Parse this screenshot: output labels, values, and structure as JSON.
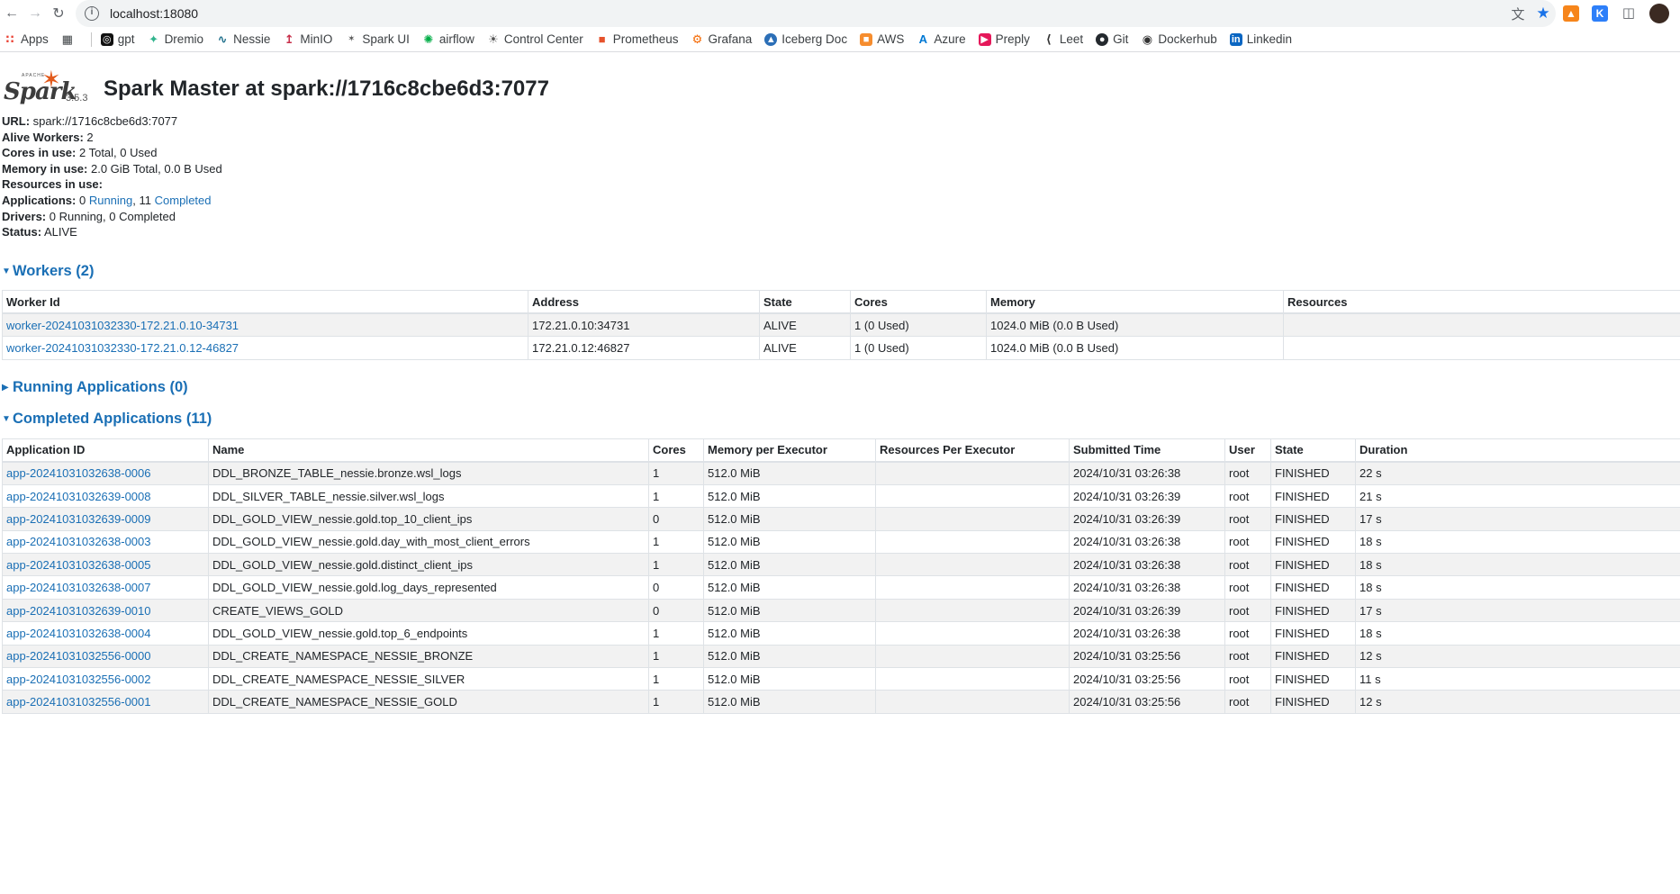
{
  "browser": {
    "url": "localhost:18080",
    "bookmarks": [
      "Apps",
      "gpt",
      "Dremio",
      "Nessie",
      "MinIO",
      "Spark UI",
      "airflow",
      "Control Center",
      "Prometheus",
      "Grafana",
      "Iceberg Doc",
      "AWS",
      "Azure",
      "Preply",
      "Leet",
      "Git",
      "Dockerhub",
      "Linkedin"
    ]
  },
  "header": {
    "logo_apache": "APACHE",
    "logo_word": "Spark",
    "version": "3.5.3",
    "title": "Spark Master at spark://1716c8cbe6d3:7077"
  },
  "summary": {
    "url_label": "URL:",
    "url_value": "spark://1716c8cbe6d3:7077",
    "workers_label": "Alive Workers:",
    "workers_value": "2",
    "cores_label": "Cores in use:",
    "cores_value": "2 Total, 0 Used",
    "memory_label": "Memory in use:",
    "memory_value": "2.0 GiB Total, 0.0 B Used",
    "resources_label": "Resources in use:",
    "apps_label": "Applications:",
    "apps_running_count": "0",
    "apps_running_link": "Running",
    "apps_completed_count": "11",
    "apps_completed_link": "Completed",
    "drivers_label": "Drivers:",
    "drivers_value": "0 Running, 0 Completed",
    "status_label": "Status:",
    "status_value": "ALIVE"
  },
  "workers": {
    "heading": "Workers (2)",
    "columns": [
      "Worker Id",
      "Address",
      "State",
      "Cores",
      "Memory",
      "Resources"
    ],
    "rows": [
      [
        "worker-20241031032330-172.21.0.10-34731",
        "172.21.0.10:34731",
        "ALIVE",
        "1 (0 Used)",
        "1024.0 MiB (0.0 B Used)",
        ""
      ],
      [
        "worker-20241031032330-172.21.0.12-46827",
        "172.21.0.12:46827",
        "ALIVE",
        "1 (0 Used)",
        "1024.0 MiB (0.0 B Used)",
        ""
      ]
    ]
  },
  "running": {
    "heading": "Running Applications (0)"
  },
  "completed": {
    "heading": "Completed Applications (11)",
    "columns": [
      "Application ID",
      "Name",
      "Cores",
      "Memory per Executor",
      "Resources Per Executor",
      "Submitted Time",
      "User",
      "State",
      "Duration"
    ],
    "rows": [
      [
        "app-20241031032638-0006",
        "DDL_BRONZE_TABLE_nessie.bronze.wsl_logs",
        "1",
        "512.0 MiB",
        "",
        "2024/10/31 03:26:38",
        "root",
        "FINISHED",
        "22 s"
      ],
      [
        "app-20241031032639-0008",
        "DDL_SILVER_TABLE_nessie.silver.wsl_logs",
        "1",
        "512.0 MiB",
        "",
        "2024/10/31 03:26:39",
        "root",
        "FINISHED",
        "21 s"
      ],
      [
        "app-20241031032639-0009",
        "DDL_GOLD_VIEW_nessie.gold.top_10_client_ips",
        "0",
        "512.0 MiB",
        "",
        "2024/10/31 03:26:39",
        "root",
        "FINISHED",
        "17 s"
      ],
      [
        "app-20241031032638-0003",
        "DDL_GOLD_VIEW_nessie.gold.day_with_most_client_errors",
        "1",
        "512.0 MiB",
        "",
        "2024/10/31 03:26:38",
        "root",
        "FINISHED",
        "18 s"
      ],
      [
        "app-20241031032638-0005",
        "DDL_GOLD_VIEW_nessie.gold.distinct_client_ips",
        "1",
        "512.0 MiB",
        "",
        "2024/10/31 03:26:38",
        "root",
        "FINISHED",
        "18 s"
      ],
      [
        "app-20241031032638-0007",
        "DDL_GOLD_VIEW_nessie.gold.log_days_represented",
        "0",
        "512.0 MiB",
        "",
        "2024/10/31 03:26:38",
        "root",
        "FINISHED",
        "18 s"
      ],
      [
        "app-20241031032639-0010",
        "CREATE_VIEWS_GOLD",
        "0",
        "512.0 MiB",
        "",
        "2024/10/31 03:26:39",
        "root",
        "FINISHED",
        "17 s"
      ],
      [
        "app-20241031032638-0004",
        "DDL_GOLD_VIEW_nessie.gold.top_6_endpoints",
        "1",
        "512.0 MiB",
        "",
        "2024/10/31 03:26:38",
        "root",
        "FINISHED",
        "18 s"
      ],
      [
        "app-20241031032556-0000",
        "DDL_CREATE_NAMESPACE_NESSIE_BRONZE",
        "1",
        "512.0 MiB",
        "",
        "2024/10/31 03:25:56",
        "root",
        "FINISHED",
        "12 s"
      ],
      [
        "app-20241031032556-0002",
        "DDL_CREATE_NAMESPACE_NESSIE_SILVER",
        "1",
        "512.0 MiB",
        "",
        "2024/10/31 03:25:56",
        "root",
        "FINISHED",
        "11 s"
      ],
      [
        "app-20241031032556-0001",
        "DDL_CREATE_NAMESPACE_NESSIE_GOLD",
        "1",
        "512.0 MiB",
        "",
        "2024/10/31 03:25:56",
        "root",
        "FINISHED",
        "12 s"
      ]
    ]
  },
  "colors": {
    "link": "#1a6fb5",
    "spark_star": "#e25a1c",
    "odd_row": "#f2f2f2",
    "border": "#dee2e6"
  }
}
